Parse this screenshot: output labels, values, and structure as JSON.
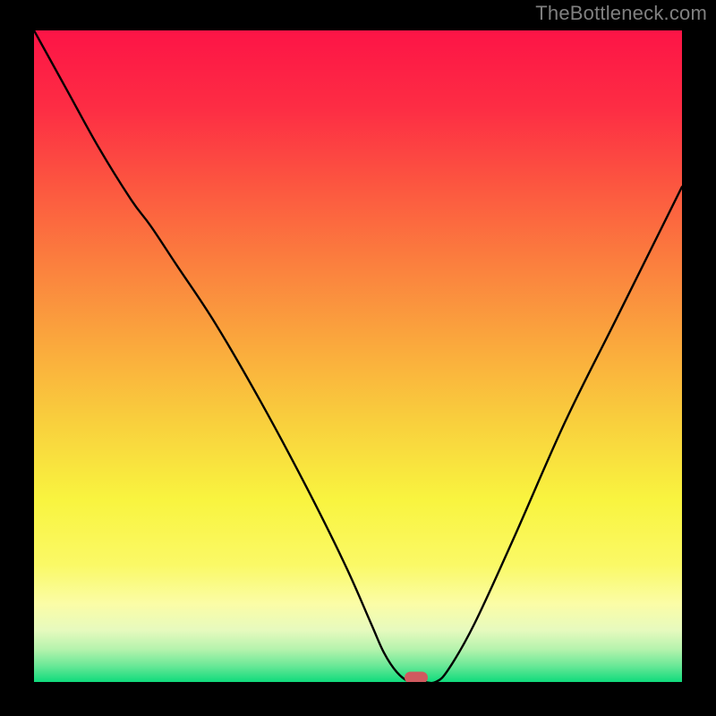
{
  "watermark": "TheBottleneck.com",
  "chart_data": {
    "type": "line",
    "title": "",
    "xlabel": "",
    "ylabel": "",
    "xlim": [
      0,
      100
    ],
    "ylim": [
      0,
      100
    ],
    "series": [
      {
        "name": "bottleneck-curve",
        "x": [
          0,
          5,
          10,
          15,
          18,
          22,
          28,
          35,
          42,
          48,
          52,
          54,
          56,
          58,
          60,
          62,
          64,
          68,
          74,
          82,
          90,
          100
        ],
        "y": [
          100,
          91,
          82,
          74,
          70,
          64,
          55,
          43,
          30,
          18,
          9,
          4.5,
          1.5,
          0,
          0,
          0,
          2,
          9,
          22,
          40,
          56,
          76
        ]
      }
    ],
    "marker": {
      "x": 59,
      "y": 0
    },
    "gradient_stops": [
      {
        "pos": 0.0,
        "color": "#fd1446"
      },
      {
        "pos": 0.12,
        "color": "#fd2d44"
      },
      {
        "pos": 0.24,
        "color": "#fc5740"
      },
      {
        "pos": 0.36,
        "color": "#fb803e"
      },
      {
        "pos": 0.48,
        "color": "#faa83d"
      },
      {
        "pos": 0.6,
        "color": "#f9cf3d"
      },
      {
        "pos": 0.72,
        "color": "#f9f43f"
      },
      {
        "pos": 0.82,
        "color": "#faf966"
      },
      {
        "pos": 0.88,
        "color": "#fbfda6"
      },
      {
        "pos": 0.92,
        "color": "#e7fabe"
      },
      {
        "pos": 0.95,
        "color": "#b5f3ad"
      },
      {
        "pos": 0.975,
        "color": "#6ae897"
      },
      {
        "pos": 1.0,
        "color": "#10db7c"
      }
    ]
  }
}
